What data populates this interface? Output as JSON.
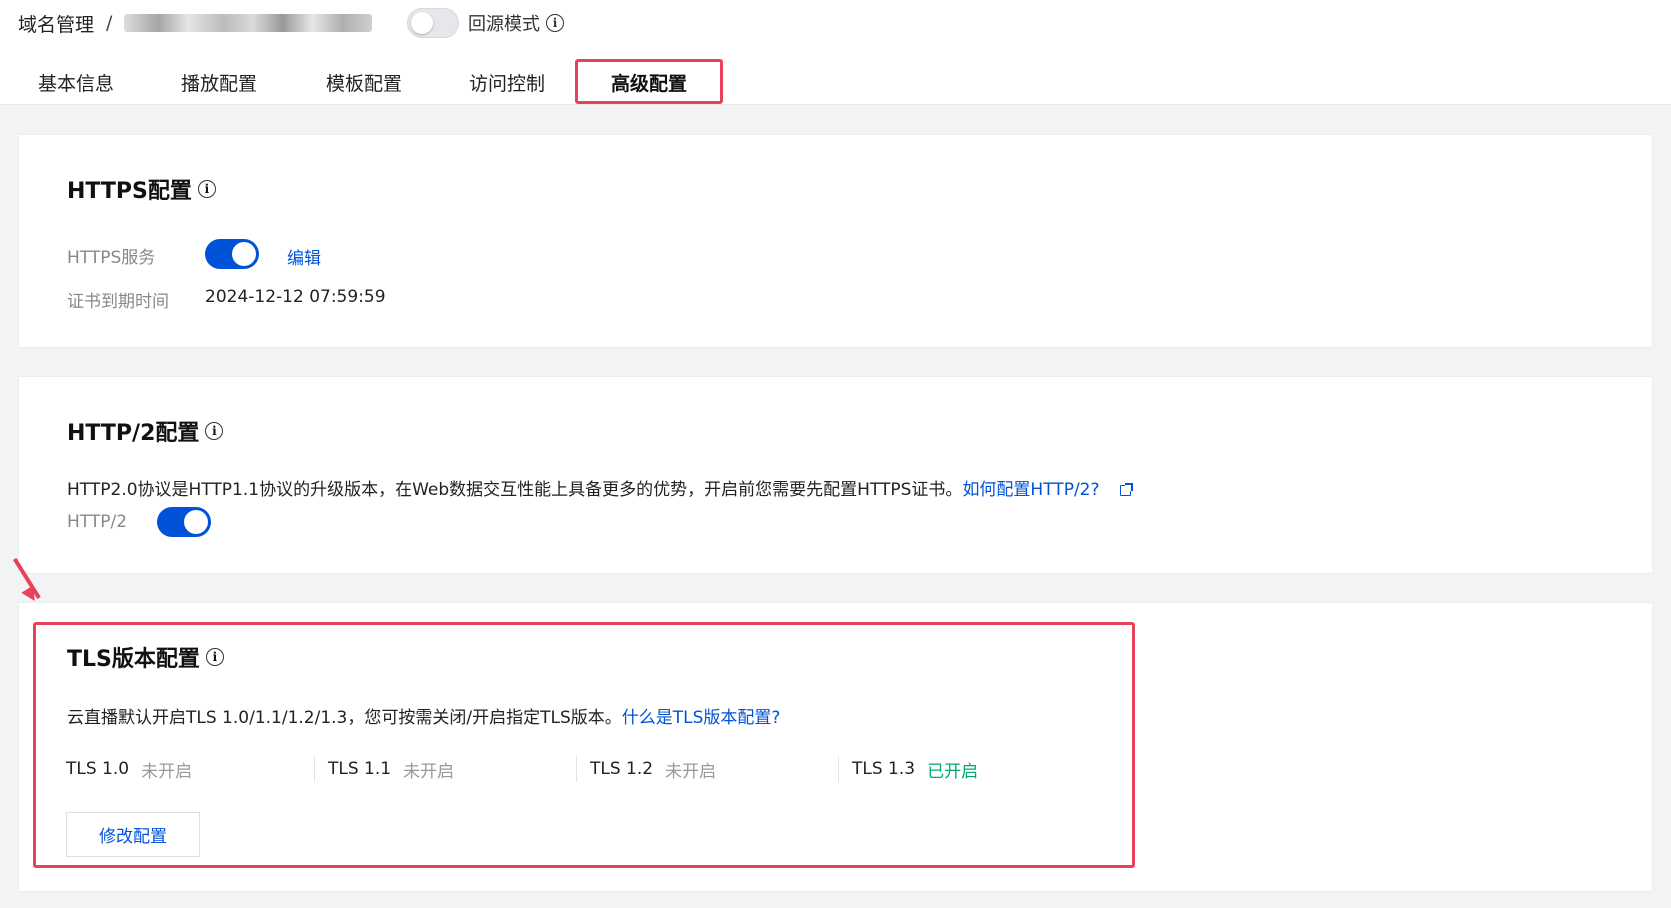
{
  "breadcrumb": {
    "root": "域名管理",
    "separator": "/"
  },
  "origin_mode": {
    "label": "回源模式",
    "enabled": false
  },
  "tabs": [
    {
      "label": "基本信息",
      "active": false
    },
    {
      "label": "播放配置",
      "active": false
    },
    {
      "label": "模板配置",
      "active": false
    },
    {
      "label": "访问控制",
      "active": false
    },
    {
      "label": "高级配置",
      "active": true
    }
  ],
  "https": {
    "title": "HTTPS配置",
    "service_label": "HTTPS服务",
    "service_enabled": true,
    "edit_label": "编辑",
    "cert_expiry_label": "证书到期时间",
    "cert_expiry_value": "2024-12-12 07:59:59"
  },
  "http2": {
    "title": "HTTP/2配置",
    "description": "HTTP2.0协议是HTTP1.1协议的升级版本，在Web数据交互性能上具备更多的优势，开启前您需要先配置HTTPS证书。",
    "help_link": "如何配置HTTP/2?",
    "toggle_label": "HTTP/2",
    "enabled": true
  },
  "tls": {
    "title": "TLS版本配置",
    "description": "云直播默认开启TLS 1.0/1.1/1.2/1.3，您可按需关闭/开启指定TLS版本。",
    "help_link": "什么是TLS版本配置?",
    "versions": [
      {
        "name": "TLS 1.0",
        "status": "未开启",
        "enabled": false
      },
      {
        "name": "TLS 1.1",
        "status": "未开启",
        "enabled": false
      },
      {
        "name": "TLS 1.2",
        "status": "未开启",
        "enabled": false
      },
      {
        "name": "TLS 1.3",
        "status": "已开启",
        "enabled": true
      }
    ],
    "modify_button": "修改配置"
  },
  "colors": {
    "primary": "#0052d9",
    "success": "#00a870",
    "highlight": "#e8415a",
    "muted": "#888888"
  },
  "icons": {
    "info": "info-icon",
    "external_link": "external-link-icon"
  }
}
